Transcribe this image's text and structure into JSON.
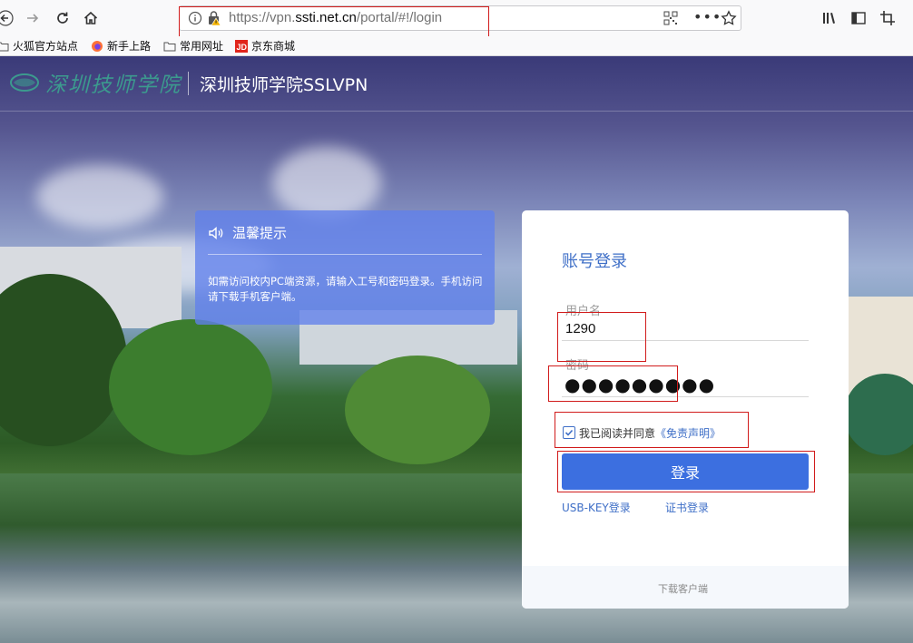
{
  "browser": {
    "url_prefix": "https://vpn.",
    "url_domain": "ssti.net.cn",
    "url_suffix": "/portal/#!/login",
    "more_label": "•••",
    "bookmarks": [
      "火狐官方站点",
      "新手上路",
      "常用网址",
      "京东商城"
    ]
  },
  "header": {
    "logo_text": "深圳技师学院",
    "title": "深圳技师学院SSLVPN"
  },
  "notice": {
    "title": "温馨提示",
    "text": "如需访问校内PC端资源，请输入工号和密码登录。手机访问请下载手机客户端。"
  },
  "login": {
    "title": "账号登录",
    "username_label": "用户名",
    "username_value": "1290",
    "password_label": "密码",
    "password_masked": "●●●●●●●●●",
    "agree_text": "我已阅读并同意",
    "agree_link": "《免责声明》",
    "agree_checked": true,
    "submit_label": "登录",
    "usbkey_label": "USB-KEY登录",
    "cert_label": "证书登录",
    "download_label": "下载客户端"
  },
  "colors": {
    "accent": "#3c6fe0",
    "title_blue": "#3f6fc7",
    "annotation_red": "#d11b1b"
  }
}
